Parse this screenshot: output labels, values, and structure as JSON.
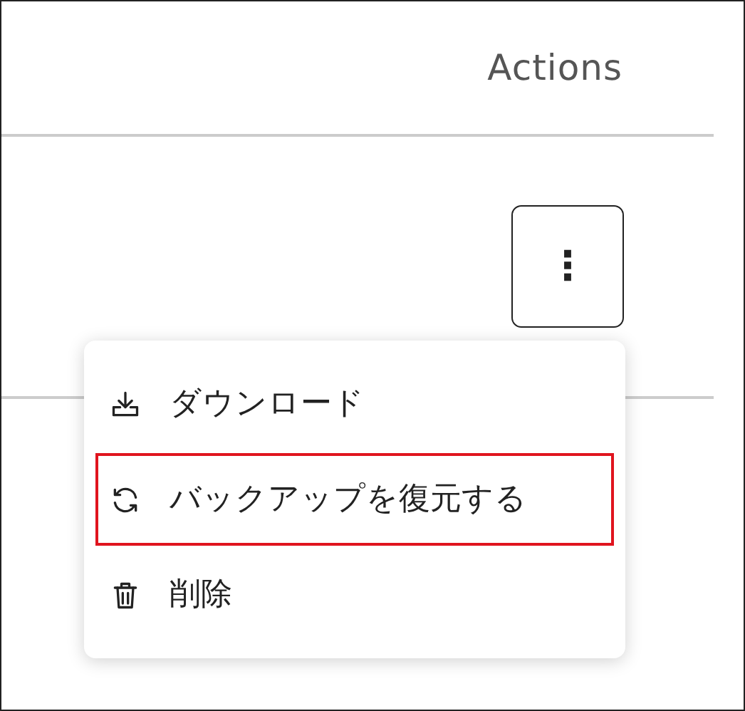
{
  "table": {
    "column_header": "Actions"
  },
  "row_menu": {
    "button_label": "⋮",
    "items": [
      {
        "kind": "download",
        "label": "ダウンロード",
        "selected": false
      },
      {
        "kind": "restore",
        "label": "バックアップを復元する",
        "selected": true
      },
      {
        "kind": "delete",
        "label": "削除",
        "selected": false
      }
    ]
  }
}
